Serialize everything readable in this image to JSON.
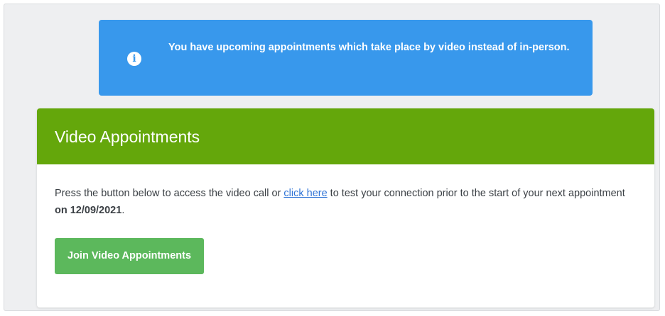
{
  "alert": {
    "icon": "info-circle-icon",
    "icon_glyph": "i",
    "message": "You have upcoming appointments which take place by video instead of in-person.",
    "color": "#3898ec"
  },
  "card": {
    "title": "Video Appointments",
    "header_color": "#64a70b",
    "text_before_link": "Press the button below to access the video call or ",
    "link_text": "click here",
    "text_after_link": " to test your connection prior to the start of your next appointment ",
    "date_text": "on 12/09/2021",
    "text_end": ".",
    "button_label": "Join Video Appointments",
    "button_color": "#5cb85c"
  }
}
